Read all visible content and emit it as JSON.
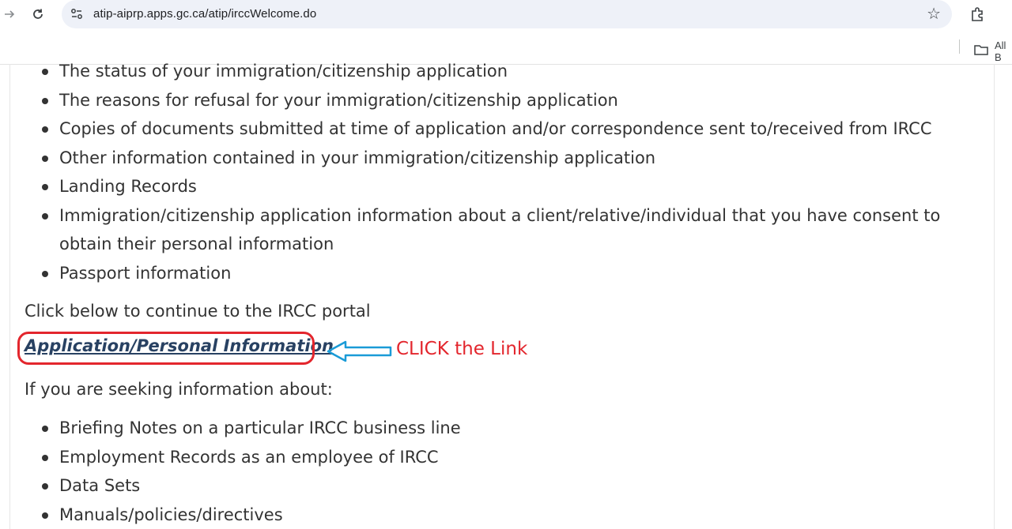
{
  "browser": {
    "url": "atip-aiprp.apps.gc.ca/atip/irccWelcome.do",
    "bookmarks_label": "All B",
    "icons": [
      "forward-icon",
      "reload-icon",
      "site-info-icon",
      "star-icon",
      "extensions-icon",
      "folder-icon"
    ]
  },
  "page": {
    "list_top": [
      "The status of your immigration/citizenship application",
      "The reasons for refusal for your immigration/citizenship application",
      "Copies of documents submitted at time of application and/or correspondence sent to/received from IRCC",
      "Other information contained in your immigration/citizenship application",
      "Landing Records",
      "Immigration/citizenship application information about a client/relative/individual that you have consent to obtain their personal information",
      "Passport information"
    ],
    "continue_text": "Click below to continue to the IRCC portal",
    "link_text": "Application/Personal Information",
    "seeking_text": "If you are seeking information about:",
    "list_bottom": [
      "Briefing Notes on a particular IRCC business line",
      "Employment Records as an employee of IRCC",
      "Data Sets",
      "Manuals/policies/directives"
    ]
  },
  "annotation": {
    "label": "CLICK the Link",
    "colors": {
      "oval": "#e3262d",
      "arrow": "#1a9bd7",
      "label": "#e3262d"
    }
  },
  "colors": {
    "link": "#284162",
    "body_text": "#333333",
    "omnibox": "#eef1f8"
  }
}
